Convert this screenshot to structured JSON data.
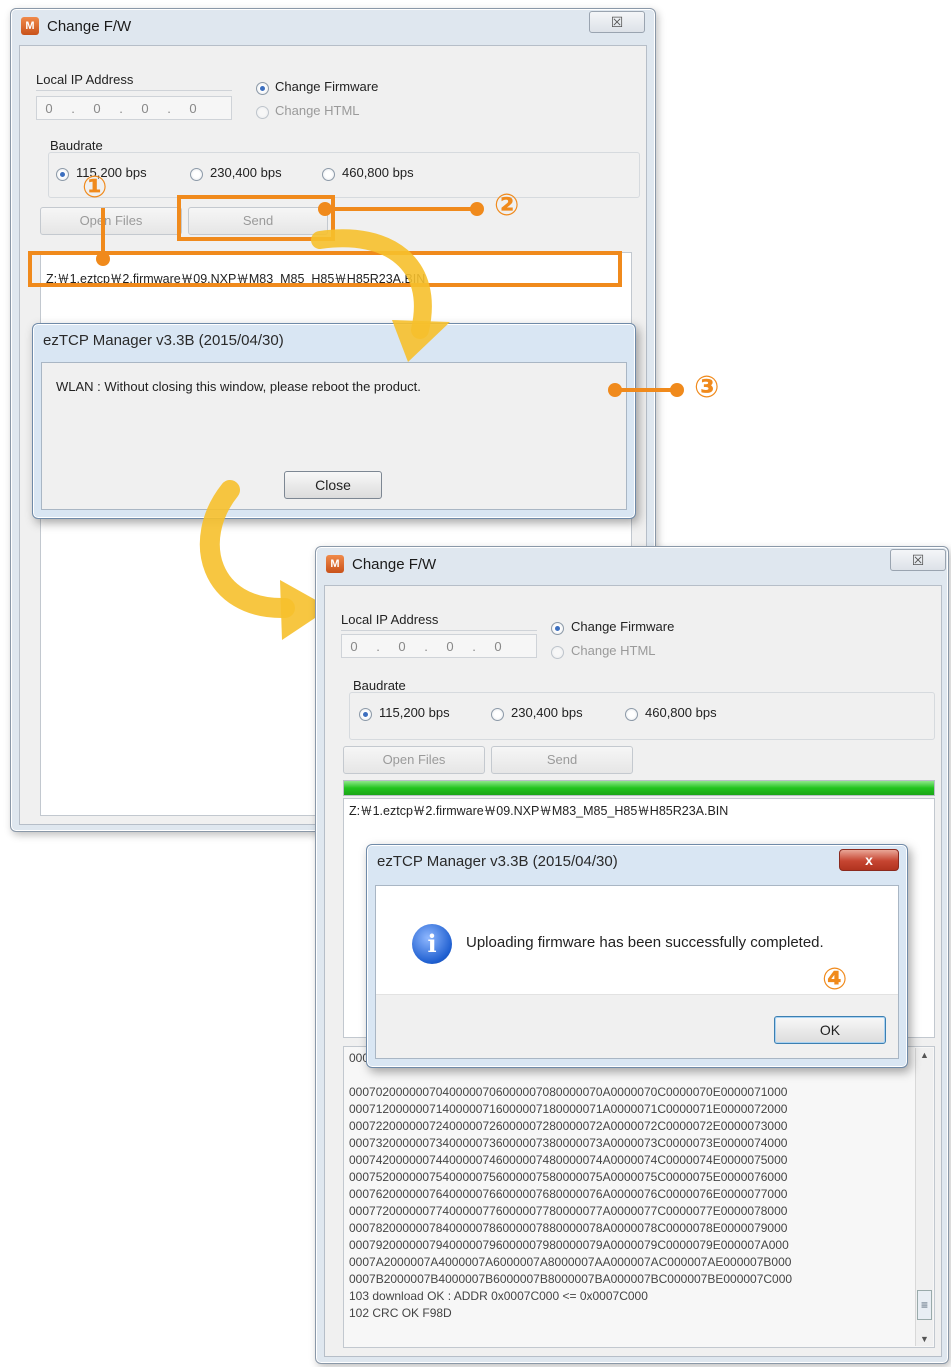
{
  "window_title": "Change F/W",
  "close_glyph": "☒",
  "app_icon": "M",
  "local_ip_label": "Local IP Address",
  "ip_octets": [
    "0",
    "0",
    "0",
    "0"
  ],
  "ip_dot": ".",
  "mode_options": {
    "firmware": "Change Firmware",
    "html": "Change HTML"
  },
  "baudrate_label": "Baudrate",
  "baud_options": [
    "115,200 bps",
    "230,400 bps",
    "460,800 bps"
  ],
  "open_files_label": "Open Files",
  "send_label": "Send",
  "file_path": "Z:￦1.eztcp￦2.firmware￦09.NXP￦M83_M85_H85￦H85R23A.BIN",
  "progress": 1.0,
  "dialog1": {
    "title": "ezTCP Manager v3.3B (2015/04/30)",
    "message": "WLAN : Without closing this window, please reboot the product.",
    "button": "Close"
  },
  "dialog2": {
    "title": "ezTCP Manager v3.3B (2015/04/30)",
    "message": "Uploading firmware has been successfully completed.",
    "button": "OK",
    "close_glyph": "x",
    "info_glyph": "i"
  },
  "log_lines": [
    "00070200000070400000706000007080000070A0000070C0000070E0000071000",
    "00071200000071400000716000007180000071A0000071C0000071E0000072000",
    "00072200000072400000726000007280000072A0000072C0000072E0000073000",
    "00073200000073400000736000007380000073A0000073C0000073E0000074000",
    "00074200000074400000746000007480000074A0000074C0000074E0000075000",
    "00075200000075400000756000007580000075A0000075C0000075E0000076000",
    "00076200000076400000766000007680000076A0000076C0000076E0000077000",
    "00077200000077400000776000007780000077A0000077C0000077E0000078000",
    "00078200000078400000786000007880000078A0000078C0000078E0000079000",
    "00079200000079400000796000007980000079A0000079C0000079E000007A000",
    "0007A2000007A4000007A6000007A8000007AA000007AC000007AE000007B000",
    "0007B2000007B4000007B6000007B8000007BA000007BC000007BE000007C000",
    "103 download OK : ADDR 0x0007C000 <= 0x0007C000",
    "102 CRC OK F98D"
  ],
  "log_partial_top": "000",
  "scroll_up": "▲",
  "scroll_down": "▼",
  "scroll_grip": "≡",
  "step_markers": [
    "①",
    "②",
    "③",
    "④"
  ],
  "colors": {
    "annotation": "#f08a1c",
    "arrow": "#f6c02c",
    "progress": "#22c41e"
  }
}
